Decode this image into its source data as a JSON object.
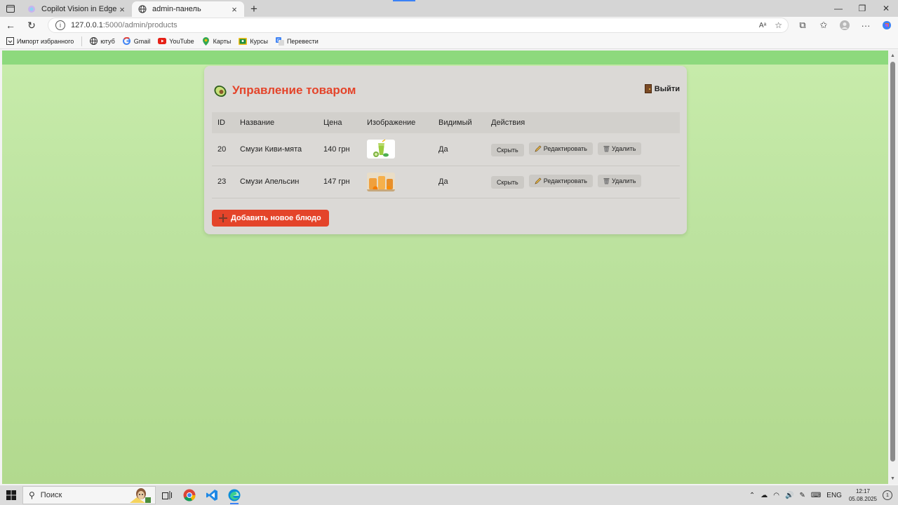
{
  "browser": {
    "tabs": [
      {
        "title": "Copilot Vision in Edge",
        "active": false
      },
      {
        "title": "admin-панель",
        "active": true
      }
    ],
    "url": {
      "host": "127.0.0.1",
      "path": ":5000/admin/products"
    },
    "bookmarks": [
      {
        "label": "Импорт избранного",
        "icon": "import-icon"
      },
      {
        "label": "ютуб",
        "icon": "globe-icon"
      },
      {
        "label": "Gmail",
        "icon": "google-icon"
      },
      {
        "label": "YouTube",
        "icon": "youtube-icon"
      },
      {
        "label": "Карты",
        "icon": "maps-pin-icon"
      },
      {
        "label": "Курсы",
        "icon": "classroom-icon"
      },
      {
        "label": "Перевести",
        "icon": "translate-icon"
      }
    ]
  },
  "admin": {
    "title": "Управление товаром",
    "logout_label": "Выйти",
    "columns": [
      "ID",
      "Название",
      "Цена",
      "Изображение",
      "Видимый",
      "Действия"
    ],
    "products": [
      {
        "id": "20",
        "name": "Смузи Киви-мята",
        "price": "140 грн",
        "image": "kiwi-smoothie-image",
        "visible": "Да"
      },
      {
        "id": "23",
        "name": "Смузи Апельсин",
        "price": "147 грн",
        "image": "orange-smoothie-image",
        "visible": "Да"
      }
    ],
    "actions": {
      "hide": "Скрыть",
      "edit": "Редактировать",
      "delete": "Удалить"
    },
    "add_label": "Добавить новое блюдо",
    "colors": {
      "accent": "#e4442a",
      "panel": "#dbd9d6",
      "header_bar": "#8dd97d"
    }
  },
  "taskbar": {
    "search_placeholder": "Поиск",
    "lang": "ENG",
    "time": "12:17",
    "date": "05.08.2025",
    "notifications": "1"
  }
}
